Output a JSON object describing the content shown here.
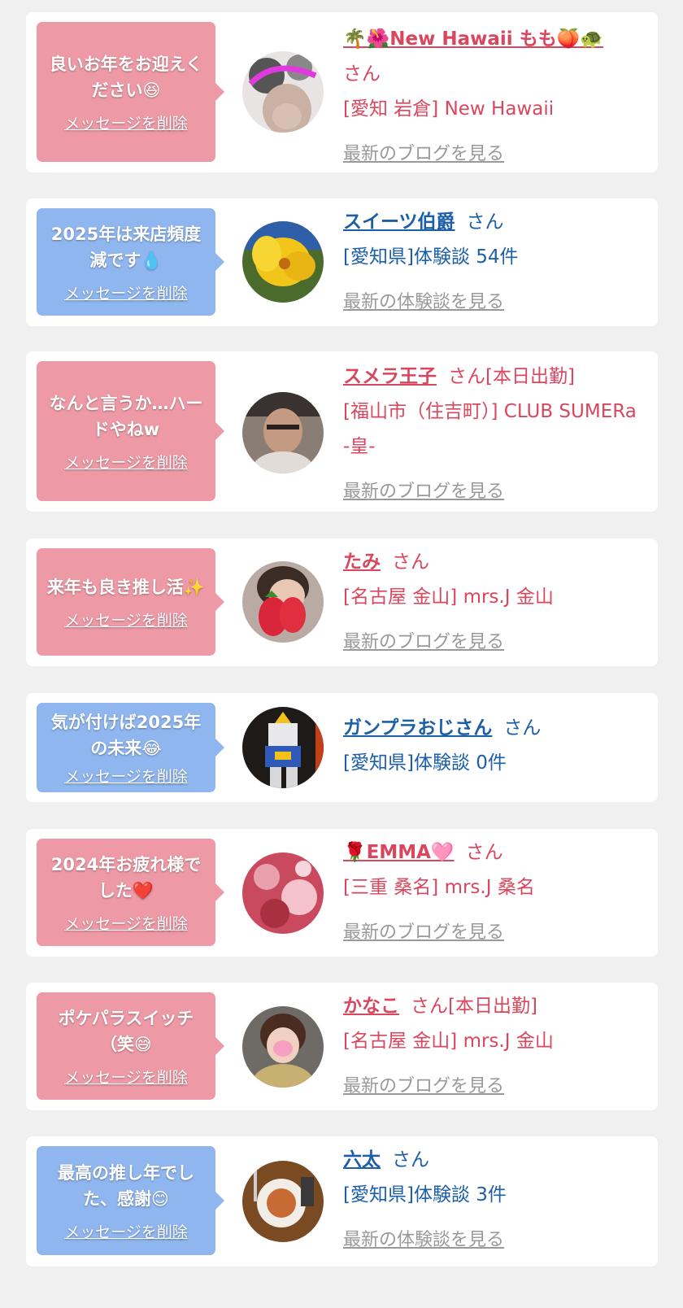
{
  "entries": [
    {
      "message": "良いお年をお迎えください😆",
      "delete_label": "メッセージを削除",
      "name": "🌴🌺New Hawaii もも🍑🐢",
      "honorific": "さん",
      "status": "",
      "location": "[愛知 岩倉] New Hawaii",
      "link": "最新のブログを見る",
      "bubble_color": "#ee9aa6",
      "text_color": "#d9475f"
    },
    {
      "message": "2025年は来店頻度減です💧",
      "delete_label": "メッセージを削除",
      "name": "スイーツ伯爵",
      "honorific": "さん",
      "status": "",
      "location": "[愛知県]体験談 54件",
      "link": "最新の体験談を見る",
      "bubble_color": "#8fb6ef",
      "text_color": "#1c5fa8"
    },
    {
      "message": "なんと言うか…ハードやねw",
      "delete_label": "メッセージを削除",
      "name": "スメラ王子",
      "honorific": "さん",
      "status": "[本日出勤]",
      "location": "[福山市（住吉町）] CLUB SUMERa -皇-",
      "link": "最新のブログを見る",
      "bubble_color": "#ee9aa6",
      "text_color": "#d9475f"
    },
    {
      "message": "来年も良き推し活✨",
      "delete_label": "メッセージを削除",
      "name": "たみ",
      "honorific": "さん",
      "status": "",
      "location": "[名古屋 金山] mrs.J 金山",
      "link": "最新のブログを見る",
      "bubble_color": "#ee9aa6",
      "text_color": "#d9475f"
    },
    {
      "message": "気が付けば2025年の未来😂",
      "delete_label": "メッセージを削除",
      "name": "ガンプラおじさん",
      "honorific": "さん",
      "status": "",
      "location": "[愛知県]体験談 0件",
      "link": "",
      "bubble_color": "#8fb6ef",
      "text_color": "#1c5fa8"
    },
    {
      "message": "2024年お疲れ様でした❤️",
      "delete_label": "メッセージを削除",
      "name": "🌹EMMA🩷",
      "honorific": "さん",
      "status": "",
      "location": "[三重 桑名] mrs.J 桑名",
      "link": "最新のブログを見る",
      "bubble_color": "#ee9aa6",
      "text_color": "#d9475f"
    },
    {
      "message": "ポケパラスイッチ（笑😅",
      "delete_label": "メッセージを削除",
      "name": "かなこ",
      "honorific": "さん",
      "status": "[本日出勤]",
      "location": "[名古屋 金山] mrs.J 金山",
      "link": "最新のブログを見る",
      "bubble_color": "#ee9aa6",
      "text_color": "#d9475f"
    },
    {
      "message": "最高の推し年でした、感謝😊",
      "delete_label": "メッセージを削除",
      "name": "六太",
      "honorific": "さん",
      "status": "",
      "location": "[愛知県]体験談 3件",
      "link": "最新の体験談を見る",
      "bubble_color": "#8fb6ef",
      "text_color": "#1c5fa8"
    }
  ]
}
